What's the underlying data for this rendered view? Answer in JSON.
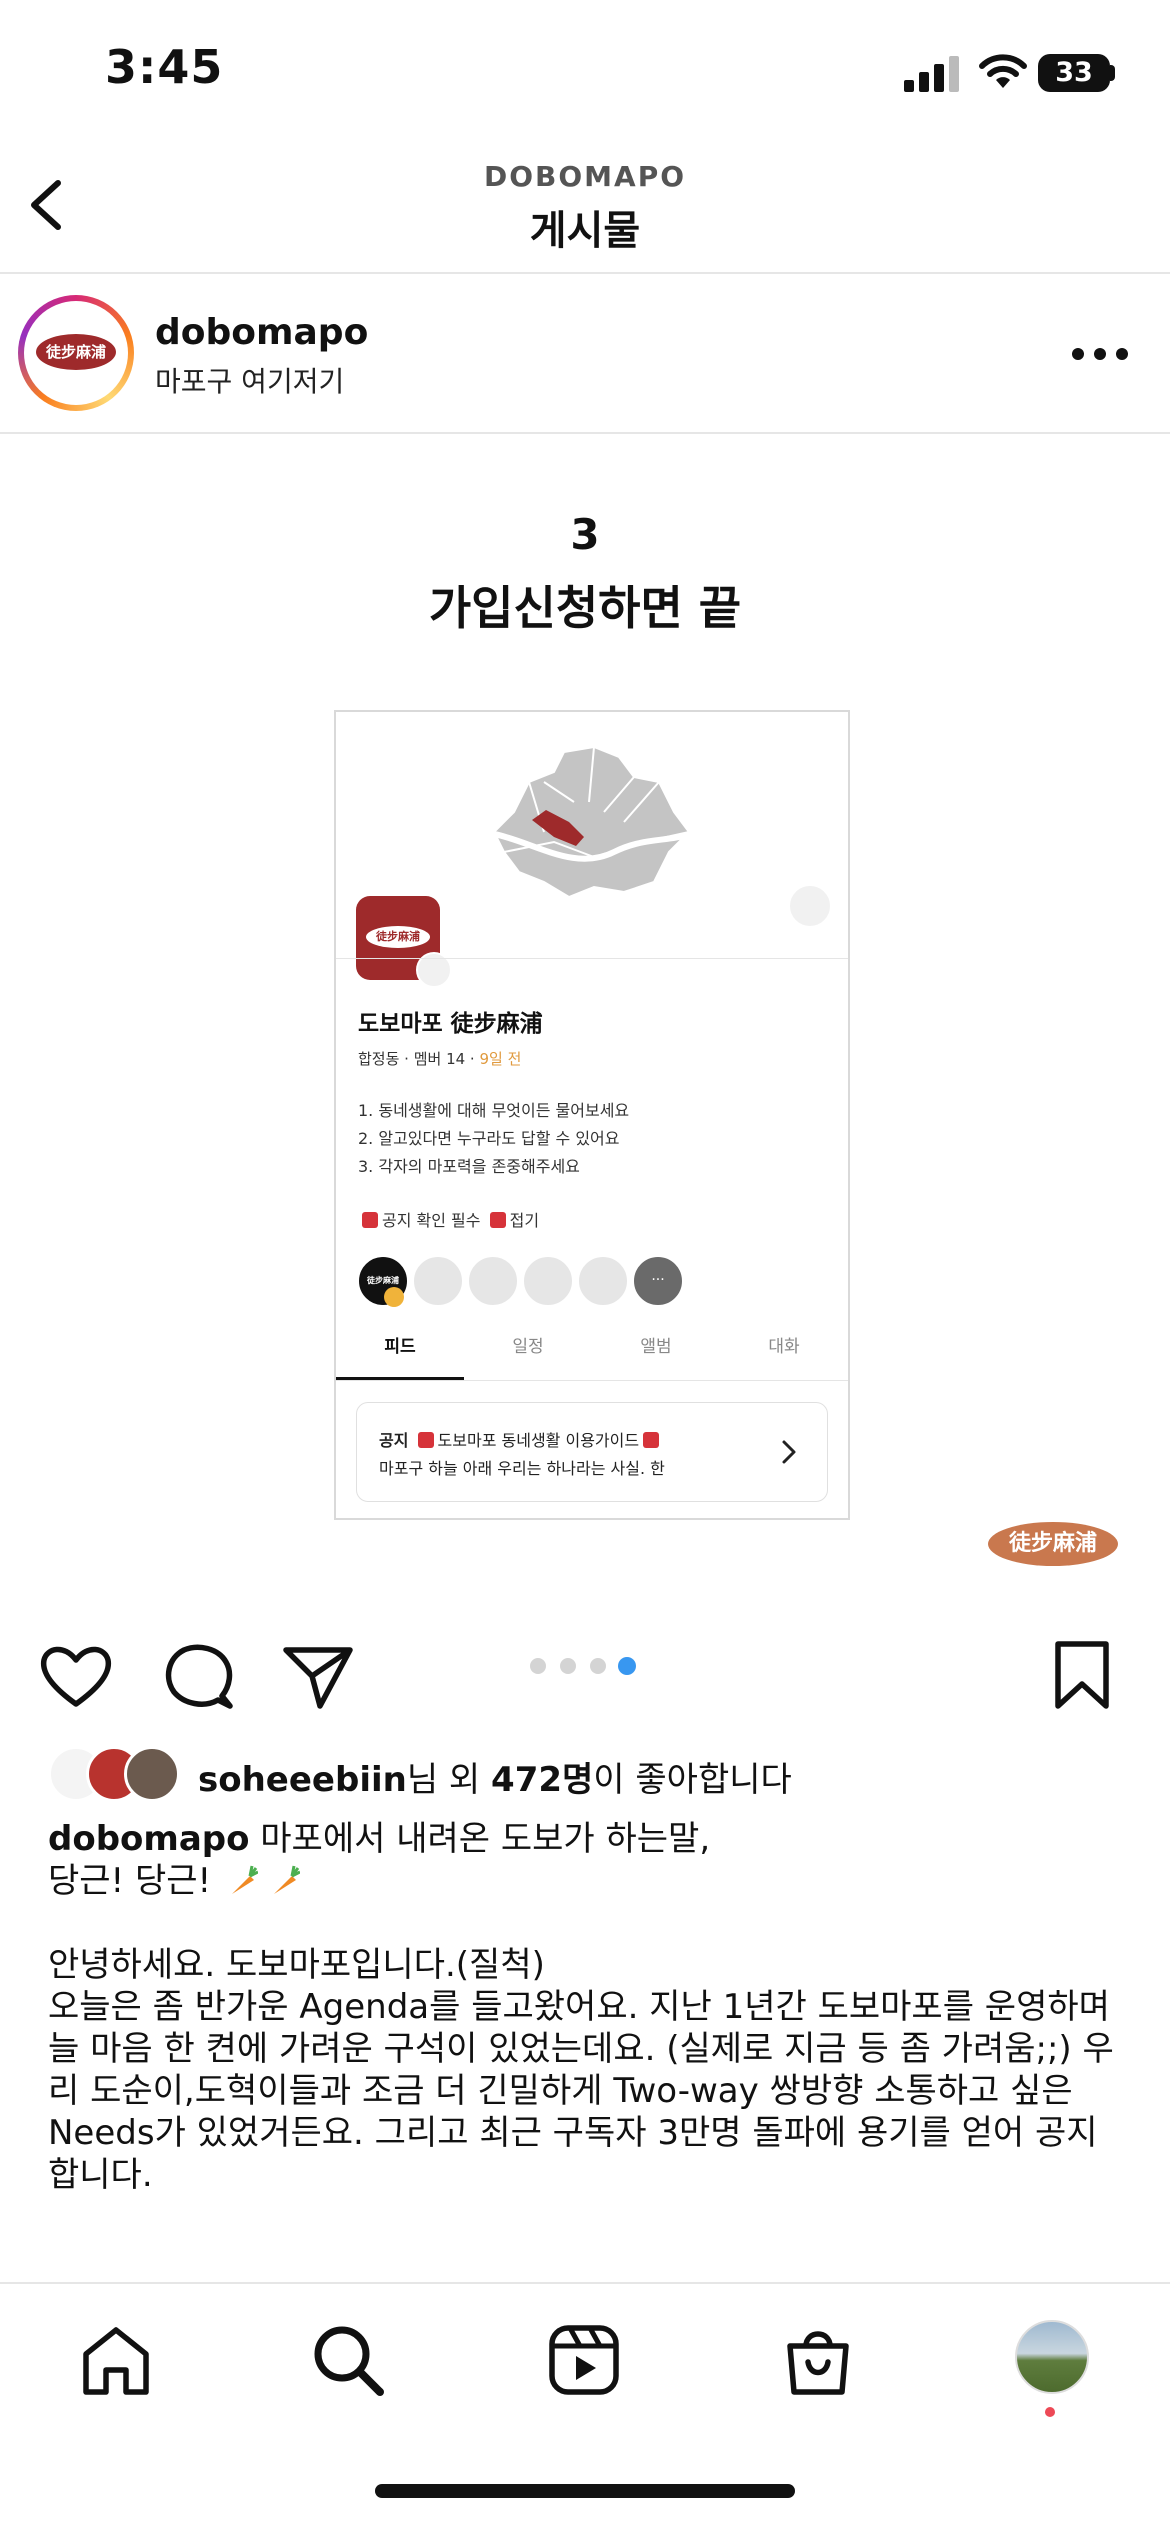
{
  "status_bar": {
    "time": "3:45",
    "battery": "33"
  },
  "header": {
    "account_caps": "DOBOMAPO",
    "title": "게시물"
  },
  "post_author": {
    "username": "dobomapo",
    "location": "마포구 여기저기",
    "logo_text": "徒步麻浦"
  },
  "slide": {
    "number": "3",
    "title": "가입신청하면 끝",
    "card": {
      "logo_text": "徒步麻浦",
      "group_name": "도보마포 徒步麻浦",
      "meta_prefix": "합정동 · 멤버 14 · ",
      "meta_accent": "9일 전",
      "rules": [
        "1. 동네생활에 대해 무엇이든 물어보세요",
        "2. 알고있다면 누구라도 답할 수 있어요",
        "3. 각자의 마포력을 존중해주세요"
      ],
      "notice_tags": [
        "공지 확인 필수",
        "접기"
      ],
      "tabs": [
        "피드",
        "일정",
        "앨범",
        "대화"
      ],
      "notice_label": "공지",
      "notice_title": "도보마포 동네생활 이용가이드",
      "notice_preview": "마포구 하늘 아래 우리는 하나라는 사실. 한",
      "member_logo_text": "徒步麻浦",
      "member_more": "···"
    },
    "watermark": "徒步麻浦",
    "pagination": {
      "count": 4,
      "active_index": 3
    }
  },
  "likes": {
    "user": "soheeebiin",
    "suffix_1": "님 외 ",
    "count": "472명",
    "suffix_2": "이 좋아합니다"
  },
  "caption": {
    "username": "dobomapo",
    "line1": " 마포에서 내려온 도보가 하는말,",
    "line2": "당근! 당근! ",
    "greeting": "안녕하세요. 도보마포입니다.(질척)",
    "body": "오늘은 좀 반가운 Agenda를 들고왔어요. 지난 1년간 도보마포를 운영하며 늘 마음 한 켠에 가려운 구석이 있었는데요. (실제로 지금 등 좀 가려움;;) 우리 도순이,도혁이들과 조금 더 긴밀하게 Two-way 쌍방향 소통하고 싶은 Needs가 있었거든요. 그리고 최근 구독자 3만명 돌파에 용기를 얻어 공지합니다."
  },
  "colors": {
    "brand": "#9e2a2b",
    "accent": "#e09a3e",
    "active_dot": "#3897f0",
    "notification": "#ed4956"
  },
  "icons": [
    "back-chevron-icon",
    "more-icon",
    "heart-icon",
    "comment-icon",
    "share-icon",
    "bookmark-icon",
    "home-icon",
    "search-icon",
    "reels-icon",
    "shop-icon"
  ]
}
